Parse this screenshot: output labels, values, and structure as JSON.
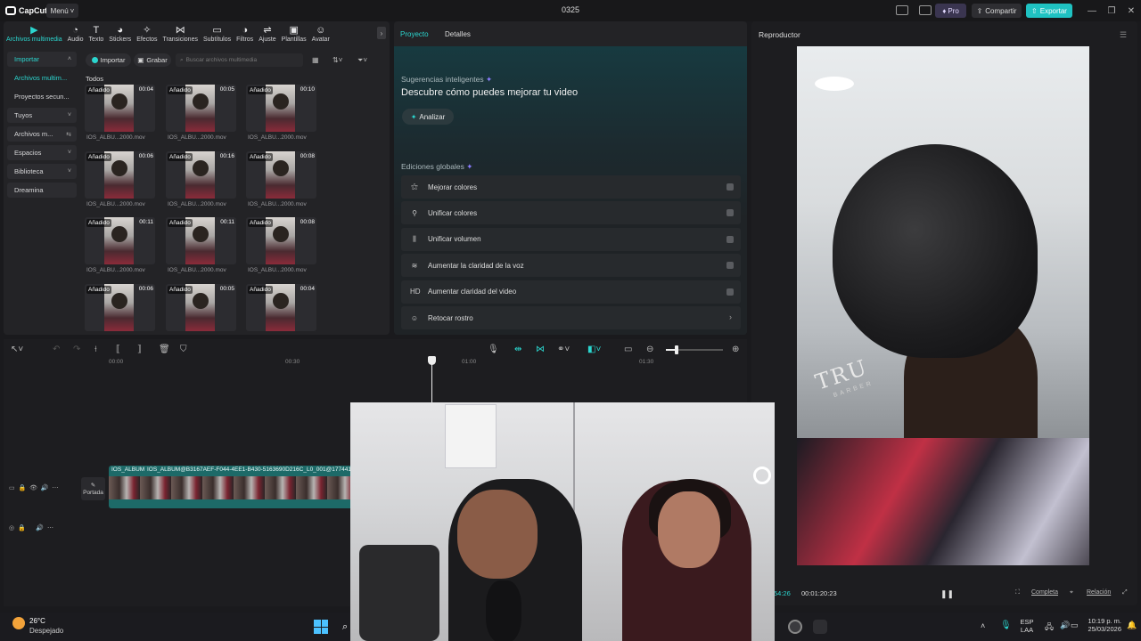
{
  "app": {
    "name": "CapCut",
    "menu_label": "Menú",
    "project_title": "0325",
    "pro_label": "Pro",
    "share_label": "Compartir",
    "export_label": "Exportar",
    "accent_color": "#1fc2c2"
  },
  "toolbar_tabs": [
    {
      "label": "Archivos multimedia",
      "icon": "media-icon",
      "active": true
    },
    {
      "label": "Audio",
      "icon": "audio-icon"
    },
    {
      "label": "Texto",
      "icon": "text-icon"
    },
    {
      "label": "Stickers",
      "icon": "sticker-icon"
    },
    {
      "label": "Efectos",
      "icon": "effects-icon"
    },
    {
      "label": "Transiciones",
      "icon": "transition-icon"
    },
    {
      "label": "Subtítulos",
      "icon": "subtitle-icon"
    },
    {
      "label": "Filtros",
      "icon": "filter-icon"
    },
    {
      "label": "Ajuste",
      "icon": "adjust-icon"
    },
    {
      "label": "Plantillas",
      "icon": "template-icon"
    },
    {
      "label": "Avatar",
      "icon": "avatar-icon"
    }
  ],
  "sidebar": {
    "items": [
      {
        "label": "Importar",
        "chevron": "˄",
        "active": true,
        "boxed": true
      },
      {
        "label": "Archivos multim...",
        "chevron": "",
        "active": true,
        "boxed": false
      },
      {
        "label": "Proyectos secun...",
        "chevron": "",
        "active": false,
        "boxed": false
      },
      {
        "label": "Tuyos",
        "chevron": "˅",
        "active": false,
        "boxed": true
      },
      {
        "label": "Archivos m...",
        "chevron": "⇆",
        "active": false,
        "boxed": true
      },
      {
        "label": "Espacios",
        "chevron": "˅",
        "active": false,
        "boxed": true
      },
      {
        "label": "Biblioteca",
        "chevron": "˅",
        "active": false,
        "boxed": true
      },
      {
        "label": "Dreamina",
        "chevron": "",
        "active": false,
        "boxed": true
      }
    ]
  },
  "media": {
    "import_label": "Importar",
    "record_label": "Grabar",
    "search_placeholder": "Buscar archivos multimedia",
    "all_label": "Todos",
    "added_label": "Añadido",
    "items": [
      {
        "duration": "00:04",
        "name": "IOS_ALBU...2000.mov"
      },
      {
        "duration": "00:05",
        "name": "IOS_ALBU...2000.mov"
      },
      {
        "duration": "00:10",
        "name": "IOS_ALBU...2000.mov"
      },
      {
        "duration": "00:06",
        "name": "IOS_ALBU...2000.mov"
      },
      {
        "duration": "00:16",
        "name": "IOS_ALBU...2000.mov"
      },
      {
        "duration": "00:08",
        "name": "IOS_ALBU...2000.mov"
      },
      {
        "duration": "00:11",
        "name": "IOS_ALBU...2000.mov"
      },
      {
        "duration": "00:11",
        "name": "IOS_ALBU...2000.mov"
      },
      {
        "duration": "00:08",
        "name": "IOS_ALBU...2000.mov"
      },
      {
        "duration": "00:06",
        "name": ""
      },
      {
        "duration": "00:05",
        "name": ""
      },
      {
        "duration": "00:04",
        "name": ""
      }
    ]
  },
  "project_panel": {
    "tabs": [
      {
        "label": "Proyecto",
        "active": true
      },
      {
        "label": "Detalles",
        "active": false
      }
    ],
    "suggestions_title": "Sugerencias inteligentes",
    "suggestions_subtitle": "Descubre cómo puedes mejorar tu video",
    "analyze_label": "Analizar",
    "global_title": "Ediciones globales",
    "global_items": [
      {
        "label": "Mejorar colores",
        "icon": "sparkle-wand-icon",
        "kind": "toggle"
      },
      {
        "label": "Unificar colores",
        "icon": "color-wand-icon",
        "kind": "toggle"
      },
      {
        "label": "Unificar volumen",
        "icon": "sliders-icon",
        "kind": "toggle"
      },
      {
        "label": "Aumentar la claridad de la voz",
        "icon": "waveform-icon",
        "kind": "toggle"
      },
      {
        "label": "Aumentar claridad del video",
        "icon": "hd-icon",
        "kind": "toggle"
      },
      {
        "label": "Retocar rostro",
        "icon": "face-retouch-icon",
        "kind": "arrow"
      }
    ]
  },
  "player": {
    "title": "Reproductor",
    "current_time": "54:26",
    "total_time": "00:01:20:23",
    "full_label": "Completa",
    "ratio_label": "Relación",
    "brand_text": "TRU",
    "brand_sub": "BARBER"
  },
  "timeline": {
    "ruler": [
      "00:00",
      "00:30",
      "01:00",
      "01:30"
    ],
    "cover_label": "Portada",
    "clip_label_short": "IOS_ALBUM",
    "clip_label": "IOS_ALBUM@B3167AEF-F044-4EE1-B430-5163690D216C_L0_001@1774415"
  },
  "taskbar": {
    "temperature": "26°C",
    "weather": "Despejado",
    "lang": "ESP",
    "layout": "LAA",
    "time": "10:19 p. m.",
    "date": "25/03/2026"
  }
}
